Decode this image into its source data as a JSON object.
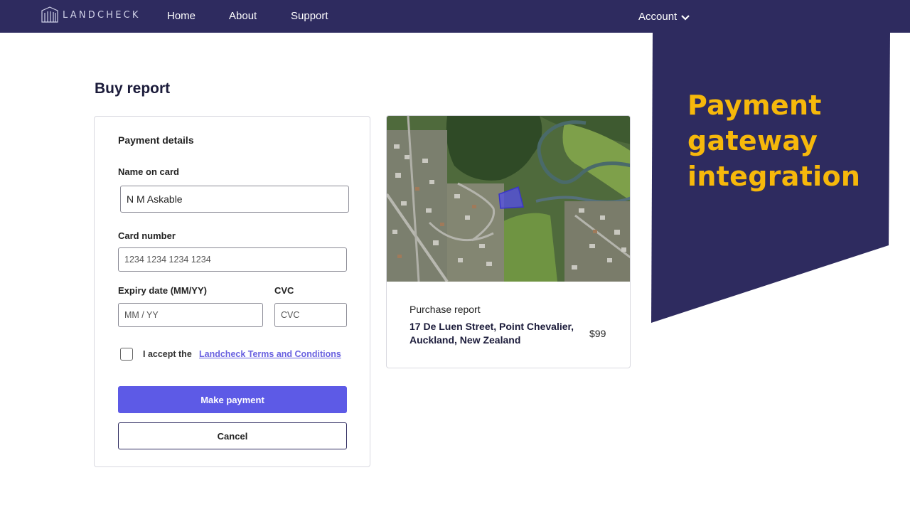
{
  "nav": {
    "logo_text": "LANDCHECK",
    "links": [
      "Home",
      "About",
      "Support"
    ],
    "account_label": "Account"
  },
  "banner": {
    "text": "Payment gateway integration",
    "color": "#f6b80b",
    "background": "#2e2b5f"
  },
  "page": {
    "title": "Buy report"
  },
  "payment": {
    "section_title": "Payment details",
    "name_label": "Name on card",
    "name_value": "N M Askable",
    "card_label": "Card number",
    "card_placeholder": "1234 1234 1234 1234",
    "expiry_label": "Expiry date (MM/YY)",
    "expiry_placeholder": "MM / YY",
    "cvc_label": "CVC",
    "cvc_placeholder": "CVC",
    "accept_text": "I accept the",
    "terms_link": "Landcheck Terms and Conditions",
    "pay_button": "Make payment",
    "cancel_button": "Cancel"
  },
  "report": {
    "purchase_label": "Purchase report",
    "address": "17 De Luen Street, Point Chevalier, Auckland, New Zealand",
    "price": "$99"
  },
  "colors": {
    "navbar": "#2e2b5f",
    "primary_button": "#5d5ae6",
    "link": "#6a62e0"
  }
}
